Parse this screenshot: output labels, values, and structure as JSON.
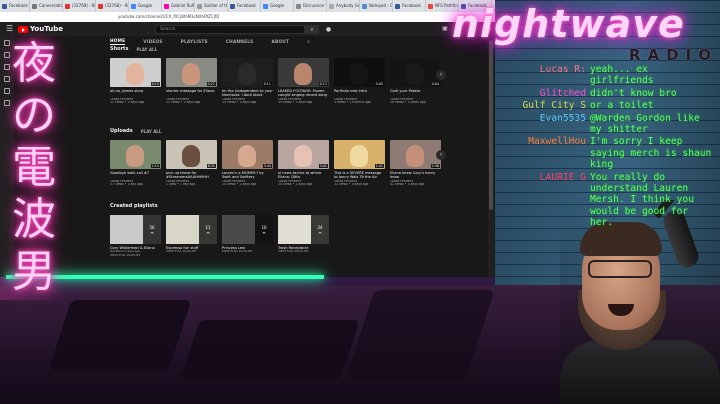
{
  "overlay": {
    "logo_title": "nightwave",
    "logo_sub": "RADIO",
    "kanji": [
      "夜",
      "の",
      "電",
      "波",
      "男"
    ],
    "neon_color": "#33ffb4"
  },
  "chat": [
    {
      "user": "Lucas R:",
      "user_color": "#ff6f8a",
      "msg": "yeah... ex girlfriends"
    },
    {
      "user": "Glitched",
      "user_color": "#ff4fd0",
      "msg": "didn't know bro"
    },
    {
      "user": "Gulf City S",
      "user_color": "#d8d848",
      "msg": "or a toilet"
    },
    {
      "user": "Evan5535",
      "user_color": "#59c8ff",
      "msg": "@Warden Gordon like my shitter"
    },
    {
      "user": "MaxwellHou",
      "user_color": "#ff7a3a",
      "msg": "I'm sorry I keep saying merch is shaun king"
    },
    {
      "user": "LAURIE G",
      "user_color": "#ff3f6a",
      "msg": "You really do understand Lauren Mersh. I think you would be good for her."
    }
  ],
  "browser": {
    "tabs": [
      {
        "label": "Facebook",
        "color": "#3b5998"
      },
      {
        "label": "Conversation Netw",
        "color": "#777"
      },
      {
        "label": "(32769) - BCT LLS Ep",
        "color": "#d33"
      },
      {
        "label": "(32768) - BCT LLS Ep",
        "color": "#d33"
      },
      {
        "label": "Google",
        "color": "#4285f4"
      },
      {
        "label": "Gabriel Rufian Go...",
        "color": "#f0a"
      },
      {
        "label": "Soldier of the Vic",
        "color": "#999"
      },
      {
        "label": "Facebook",
        "color": "#3b5998"
      },
      {
        "label": "Google",
        "color": "#4285f4"
      },
      {
        "label": "Discussion Wiki ...",
        "color": "#888"
      },
      {
        "label": "Anybody Gets Ins",
        "color": "#aaa"
      },
      {
        "label": "Notepad - Chaton",
        "color": "#58c"
      },
      {
        "label": "Facebook",
        "color": "#3b5998"
      },
      {
        "label": "NFS Pathfinder Mac",
        "color": "#e44"
      },
      {
        "label": "Facebook",
        "color": "#3b5998"
      }
    ],
    "url": "youtube.com/channel/UCX_f0CjWhM3cNXhPtZCjfQ"
  },
  "youtube": {
    "logo": "YouTube",
    "search_placeholder": "Search",
    "channel_tabs": [
      {
        "label": "HOME",
        "active": true
      },
      {
        "label": "VIDEOS",
        "active": false
      },
      {
        "label": "PLAYLISTS",
        "active": false
      },
      {
        "label": "CHANNELS",
        "active": false
      },
      {
        "label": "ABOUT",
        "active": false
      }
    ],
    "shorts_title": "Shorts",
    "shorts_play_all": "PLAY ALL",
    "shorts": [
      {
        "title": "ok-no, James slurp",
        "channel": "Cozbz Pendent",
        "meta": "12 views • 2 days ago",
        "dur": "0:15",
        "bg": "#cfcfcf",
        "face": "#e3b49c"
      },
      {
        "title": "shorter message for Eliana",
        "channel": "Cozbz Pendent",
        "meta": "21 views • 2 days ago",
        "dur": "0:21",
        "bg": "#8a8a84",
        "face": "#c9957c"
      },
      {
        "title": "Im the Godspendent to your Narcissist. I dont block you...",
        "channel": "Cozbz Pendent",
        "meta": "14 views • 3 days ago",
        "dur": "0:11",
        "bg": "#1e1e1e",
        "face": "#2a2a2a"
      },
      {
        "title": "LEAKED FOOTAGE: Frozen caught singing record song",
        "channel": "Cozbz Pendent",
        "meta": "39 views • 2 days ago",
        "dur": "0:13",
        "bg": "#3a3a3a",
        "face": "#b7866c"
      },
      {
        "title": "Portfolio new intro",
        "channel": "Cozbz Pendent",
        "meta": "3 views • 2 months ago",
        "dur": "0:05",
        "bg": "#0f0f0f",
        "face": "#151515"
      },
      {
        "title": "Cork your Potato",
        "channel": "Cozbz Pendent",
        "meta": "26 views • 3 years ago",
        "dur": "0:04",
        "bg": "#141414",
        "face": "#1a1a1a"
      }
    ],
    "uploads_title": "Uploads",
    "uploads_play_all": "PLAY ALL",
    "uploads": [
      {
        "title": "Goodbye walk call #7",
        "channel": "Cozbz Pendent",
        "meta": "57 views • 1 day ago",
        "dur": "2:15",
        "bg": "#7a8a6e",
        "face": "#c99a82"
      },
      {
        "title": "pick up throw for #StreamersAAAHHHHH",
        "channel": "Cozbz Pendent",
        "meta": "1 view • 1 day ago",
        "dur": "6:31",
        "bg": "#c9c3b5",
        "face": "#6a4e3e"
      },
      {
        "title": "Lauren's a MOMM!!! by Swift and Swiftery",
        "channel": "Cozbz Pendent",
        "meta": "24 views • 2 days ago",
        "dur": "3:44",
        "bg": "#9c7b69",
        "face": "#d6a890"
      },
      {
        "title": "xl news tactics to whine Eliana. Ditto",
        "channel": "Cozbz Pendent",
        "meta": "24 views • 2 days ago",
        "dur": "3:01",
        "bg": "#b9a6a0",
        "face": "#e6c2b4"
      },
      {
        "title": "This is a SEVERE message to Jonny Wols Tit the Air",
        "channel": "Cozbz Pendent",
        "meta": "31 views • 3 days ago",
        "dur": "1:41",
        "bg": "#d8b26a",
        "face": "#f0d9a0"
      },
      {
        "title": "Eliana knew Cory's horny lmao",
        "channel": "Cozbz Pendent",
        "meta": "41 views • 3 days ago",
        "dur": "2:56",
        "bg": "#8e7b74",
        "face": "#c4907a"
      }
    ],
    "playlists_title": "Created playlists",
    "playlists": [
      {
        "title": "Cory Wilderman & Eliana",
        "meta": "Updated 4 days ago",
        "link": "VIEW FULL PLAYLIST",
        "count": "56",
        "bg": "#c9c9c9"
      },
      {
        "title": "Expresso fun stuff",
        "meta": "",
        "link": "VIEW FULL PLAYLIST",
        "count": "11",
        "bg": "#d8d6c8"
      },
      {
        "title": "Princess Lexi",
        "meta": "",
        "link": "VIEW FULL PLAYLIST",
        "count": "10",
        "bg": "#4a4a4a"
      },
      {
        "title": "Trash Receptacle",
        "meta": "",
        "link": "VIEW FULL PLAYLIST",
        "count": "24",
        "bg": "#e0ddd2"
      }
    ],
    "rail_label": "Shows"
  }
}
